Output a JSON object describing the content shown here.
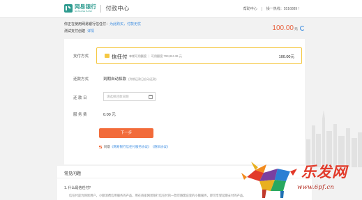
{
  "header": {
    "logo_cn": "网易银行",
    "logo_en": "NETEASE BANK",
    "title": "付款中心",
    "help_link": "帮助中心",
    "account_label": "操一热线：5516889 !"
  },
  "order": {
    "line1_prefix": "你正在使用网易银行信任付：",
    "line1_link": "为此购买，付款无忧",
    "line2_text": "测试支付创建",
    "line2_link": "详情",
    "amount": "100.00",
    "amount_unit": "元"
  },
  "form": {
    "method_label": "支付方式",
    "method_name": "信任付",
    "method_detail": "本期可用额度  ｜  可用额度 793,824.36 元",
    "method_amount": "100.00元",
    "repay_label": "还款方式",
    "repay_value": "到期自动扣款",
    "repay_note": "(到期还款日自动还款)",
    "date_label": "还 款 日",
    "date_placeholder": "请选择还款日期",
    "fee_label": "服 务 费",
    "fee_value": "0.00 元",
    "next_button": "下一步",
    "agree_prefix": "同意",
    "agree_link1": "《网易银行信任付服务协议》",
    "agree_link2": "《隐私协议》"
  },
  "faq": {
    "title": "常见问题",
    "question": "1. 什么是信任付？",
    "answer": "信任付是为网易用户，小额消费信用服务的产品，用在商家网易银行信任付的一款可随需应变的小额服务，即可享受延期支付的产品。"
  },
  "watermark": {
    "text": "乐发网",
    "url": "www.6pf.cn"
  },
  "colors": {
    "brand": "#2d9b8f",
    "accent": "#f26b3a",
    "amount": "#e8613d",
    "link": "#3a8be0",
    "method_border": "#f5c842"
  }
}
